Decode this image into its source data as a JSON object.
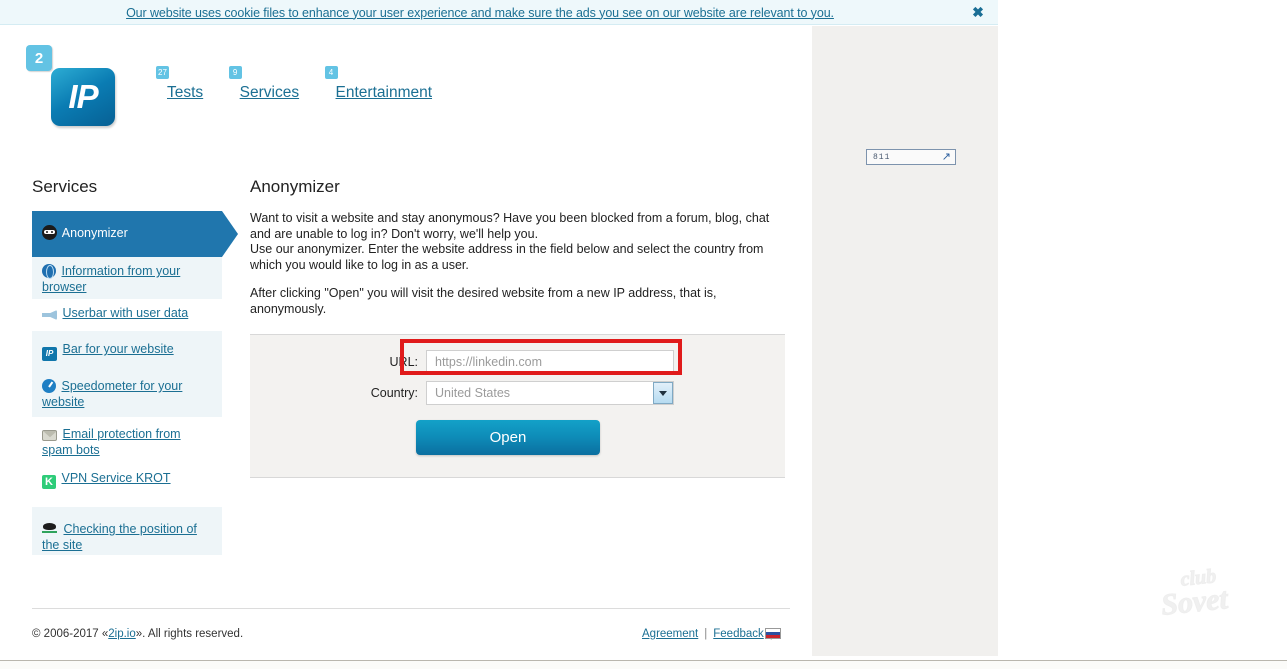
{
  "cookie_banner": {
    "message": "Our website uses cookie files to enhance your user experience and make sure the ads you see on our website are relevant to you.",
    "close_icon": "close-icon",
    "close_glyph": "✖"
  },
  "logo": {
    "badge": "2",
    "text": "IP"
  },
  "nav": {
    "items": [
      {
        "label": "Tests",
        "badge": "27"
      },
      {
        "label": "Services",
        "badge": "9"
      },
      {
        "label": "Entertainment",
        "badge": "4"
      }
    ]
  },
  "sidebar": {
    "title": "Services",
    "items": [
      {
        "label": "Anonymizer",
        "icon": "ninja-icon",
        "active": true
      },
      {
        "label": "Information from your browser",
        "icon": "globe-icon",
        "active": false
      },
      {
        "label": "Userbar with user data",
        "icon": "megaphone-icon",
        "active": false
      },
      {
        "label": "Bar for your website",
        "icon": "ip-badge-icon",
        "active": false
      },
      {
        "label": "Speedometer for your website",
        "icon": "speedometer-icon",
        "active": false
      },
      {
        "label": "Email protection from spam bots",
        "icon": "envelope-icon",
        "active": false
      },
      {
        "label": "VPN Service KROT",
        "icon": "krot-k-icon",
        "active": false
      },
      {
        "label": "Checking the position of the site",
        "icon": "bird-icon",
        "active": false
      }
    ]
  },
  "main": {
    "title": "Anonymizer",
    "paragraphs": [
      "Want to visit a website and stay anonymous? Have you been blocked from a forum, blog, chat and are unable to log in? Don't worry, we'll help you.\nUse our anonymizer. Enter the website address in the field below and select the country from which you would like to log in as a user.",
      "After clicking \"Open\" you will visit the desired website from a new IP address, that is, anonymously."
    ],
    "form": {
      "url_label": "URL:",
      "url_placeholder": "https://linkedin.com",
      "url_value": "",
      "country_label": "Country:",
      "country_value": "United States",
      "dropdown_icon": "chevron-down-icon",
      "submit_label": "Open"
    }
  },
  "ad_rail": {
    "box_text": "811",
    "arrow_icon": "external-link-arrow-icon",
    "arrow_glyph": "↗"
  },
  "footer": {
    "copyright_prefix": "© 2006-2017 «",
    "copyright_link": "2ip.io",
    "copyright_suffix": "». All rights reserved.",
    "agreement_label": "Agreement",
    "feedback_label": "Feedback",
    "separator": "|",
    "flag_icon": "russia-flag-icon"
  },
  "watermark": {
    "line1": "club",
    "line2": "Sovet"
  },
  "colors": {
    "accent": "#1b6f93",
    "active_sidebar": "#2076ad",
    "badge": "#63c3e4",
    "highlight": "#e01b1b",
    "panel": "#f3f2f0",
    "ad_rail": "#f1f0ee"
  }
}
